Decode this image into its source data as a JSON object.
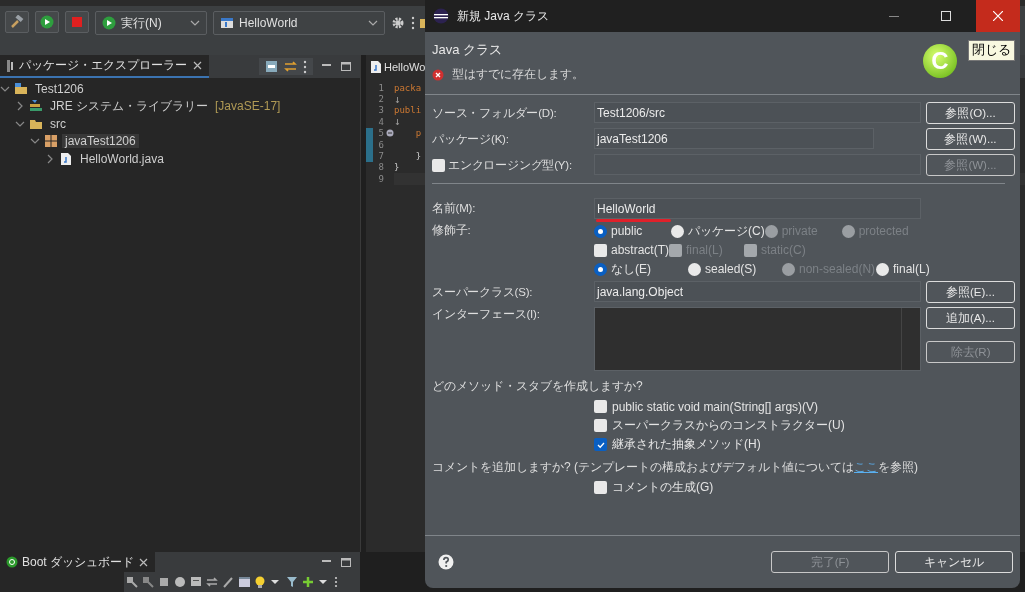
{
  "toolbar": {
    "run_combo": "実行(N)",
    "launch_combo": "HelloWorld"
  },
  "package_explorer": {
    "tab": {
      "label": "パッケージ・エクスプローラー",
      "selected": true
    },
    "tree": [
      {
        "label": "Test1206",
        "kind": "project",
        "expanded": true,
        "selected": false,
        "children": [
          {
            "label": "JRE システム・ライブラリー",
            "suffix": "[JavaSE-17]",
            "kind": "library",
            "expanded": false,
            "selected": false
          },
          {
            "label": "src",
            "kind": "folder",
            "expanded": true,
            "selected": false,
            "children": [
              {
                "label": "javaTest1206",
                "kind": "package",
                "expanded": true,
                "selected": true,
                "children": [
                  {
                    "label": "HelloWorld.java",
                    "kind": "file",
                    "expanded": false,
                    "selected": false
                  }
                ]
              }
            ]
          }
        ]
      }
    ]
  },
  "editor": {
    "tab": "HelloWo",
    "lines": [
      {
        "number": "1",
        "text": "packa",
        "kind": "keyword",
        "changed": false,
        "fold": false,
        "current": false
      },
      {
        "number": "2",
        "text": "↓",
        "kind": "whitespace",
        "changed": false,
        "fold": false,
        "current": false
      },
      {
        "number": "3",
        "text": "publi",
        "kind": "keyword",
        "changed": false,
        "fold": false,
        "current": false
      },
      {
        "number": "4",
        "text": "↓",
        "kind": "whitespace",
        "changed": false,
        "fold": false,
        "current": false
      },
      {
        "number": "5",
        "text": "    p",
        "kind": "keyword",
        "changed": true,
        "fold": true,
        "current": false
      },
      {
        "number": "6",
        "changed": true,
        "fold": false,
        "current": false
      },
      {
        "number": "7",
        "text": "    }",
        "kind": "plain",
        "changed": true,
        "fold": false,
        "current": false
      },
      {
        "number": "8",
        "text": "}",
        "kind": "plain",
        "changed": false,
        "fold": false,
        "current": false
      },
      {
        "number": "9",
        "changed": false,
        "fold": false,
        "current": true
      }
    ]
  },
  "boot_dashboard": {
    "tab": {
      "label": "Boot ダッシュボード",
      "selected": true
    }
  },
  "dialog": {
    "title": "新規 Java クラス",
    "header": "Java クラス",
    "message": "型はすでに存在します。",
    "logo_letter": "C",
    "tooltip": "閉じる",
    "rows": [
      {
        "label": "ソース・フォルダー(D):",
        "value": "Test1206/src",
        "button": {
          "label": "参照(O)...",
          "disabled": false
        }
      },
      {
        "label": "パッケージ(K):",
        "value": "javaTest1206",
        "button": {
          "label": "参照(W)...",
          "disabled": false
        }
      },
      {
        "label": "エンクロージング型(Y):",
        "checkbox": {
          "checked": false
        },
        "disabled": true,
        "button": {
          "label": "参照(W)...",
          "disabled": true
        }
      }
    ],
    "name": {
      "label": "名前(M):",
      "value": "HelloWorld",
      "underlined": true
    },
    "modifiers": {
      "label": "修飾子:",
      "rows": [
        [
          {
            "kind": "radio",
            "label": "public",
            "selected": true,
            "disabled": false
          },
          {
            "kind": "radio",
            "label": "パッケージ(C)",
            "selected": false,
            "disabled": false
          },
          {
            "kind": "radio",
            "label": "private",
            "selected": false,
            "disabled": true
          },
          {
            "kind": "radio",
            "label": "protected",
            "selected": false,
            "disabled": true
          }
        ],
        [
          {
            "kind": "checkbox",
            "label": "abstract(T)",
            "checked": false,
            "disabled": false
          },
          {
            "kind": "checkbox",
            "label": "final(L)",
            "checked": false,
            "disabled": true
          },
          {
            "kind": "checkbox",
            "label": "static(C)",
            "checked": false,
            "disabled": true
          }
        ],
        [
          {
            "kind": "radio",
            "label": "なし(E)",
            "selected": true,
            "disabled": false
          },
          {
            "kind": "radio",
            "label": "sealed(S)",
            "selected": false,
            "disabled": false
          },
          {
            "kind": "radio",
            "label": "non-sealed(N)",
            "selected": false,
            "disabled": true
          },
          {
            "kind": "radio",
            "label": "final(L)",
            "selected": false,
            "disabled": false
          }
        ]
      ]
    },
    "superclass": {
      "label": "スーパークラス(S):",
      "value": "java.lang.Object",
      "button": {
        "label": "参照(E)...",
        "disabled": false
      }
    },
    "interfaces": {
      "label": "インターフェース(I):",
      "buttons": [
        {
          "label": "追加(A)...",
          "disabled": false
        },
        {
          "label": "除去(R)",
          "disabled": true
        }
      ]
    },
    "stubs": {
      "question": "どのメソッド・スタブを作成しますか?",
      "options": [
        {
          "label": "public static void main(String[] args)(V)",
          "checked": false
        },
        {
          "label": "スーパークラスからのコンストラクター(U)",
          "checked": false
        },
        {
          "label": "継承された抽象メソッド(H)",
          "checked": true
        }
      ]
    },
    "comments": {
      "question_before": "コメントを追加しますか? (テンプレートの構成およびデフォルト値については",
      "link": "ここ",
      "question_after": "を参照)",
      "options": [
        {
          "label": "コメントの生成(G)",
          "checked": false
        }
      ]
    },
    "footer": {
      "buttons": [
        {
          "label": "完了(F)",
          "disabled": true
        },
        {
          "label": "キャンセル",
          "disabled": false
        }
      ]
    }
  }
}
